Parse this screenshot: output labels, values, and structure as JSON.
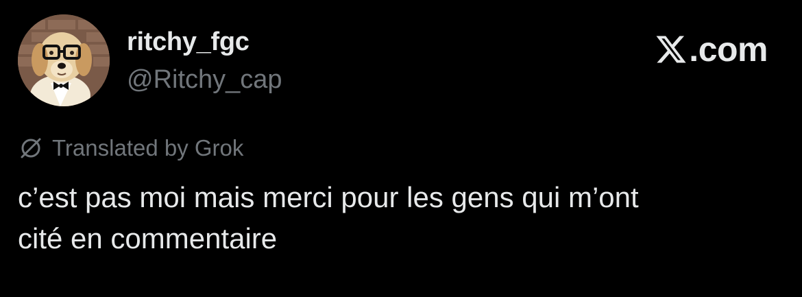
{
  "post": {
    "display_name": "ritchy_fgc",
    "handle": "@Ritchy_cap",
    "avatar_icon": "dog-with-glasses-avatar",
    "brand": {
      "icon": "x-logo-icon",
      "text": ".com"
    },
    "translation_notice": {
      "icon": "translate-slash-icon",
      "text": "Translated by Grok"
    },
    "text": "c’est pas moi mais merci pour les gens qui m’ont\ncité en commentaire"
  },
  "colors": {
    "background": "#000000",
    "primary_text": "#e7e9ea",
    "secondary_text": "#71767b"
  }
}
